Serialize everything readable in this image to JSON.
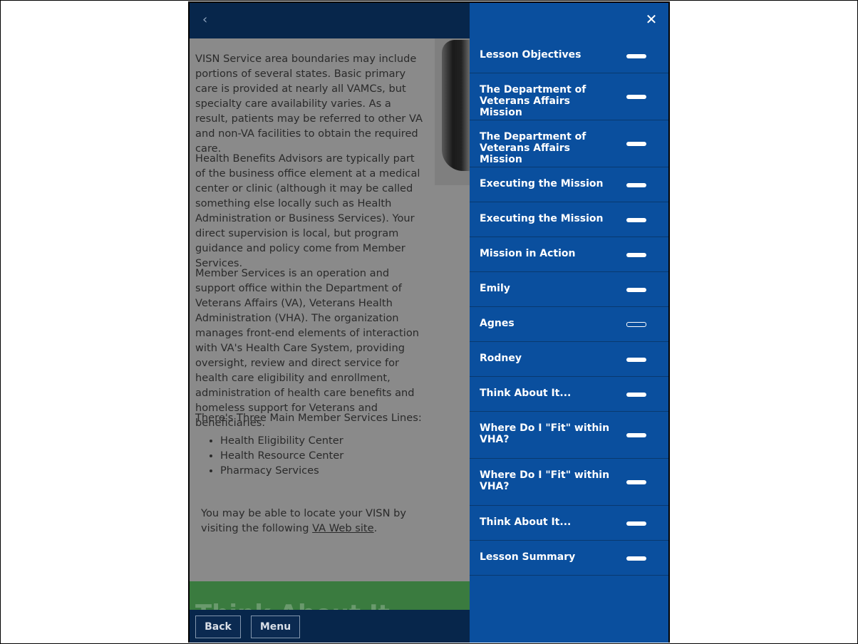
{
  "header": {
    "back_icon": "chevron-left-icon"
  },
  "article": {
    "p1": "VISN Service area boundaries may include portions of several states. Basic primary care is provided at nearly all VAMCs, but specialty care availability varies. As a result, patients may be referred to other VA and non-VA facilities to obtain the required care.",
    "p2": "Health Benefits Advisors are typically part of the business office element at a medical center or clinic (although it may be called something else locally such as Health Administration or Business Services). Your direct supervision is local, but program guidance and policy come from Member Services.",
    "p3": "Member Services is an operation and support office within the Department of Veterans Affairs (VA), Veterans Health Administration (VHA). The organization manages front-end elements of interaction with VA's Health Care System, providing oversight, review and direct service for health care eligibility and enrollment, administration of health care benefits and homeless support for Veterans and beneficiaries.",
    "p4": "There's Three Main Member Services Lines:",
    "bullets": [
      "Health Eligibility Center",
      "Health Resource Center",
      "Pharmacy Services"
    ],
    "visn_prefix": "You may be able to locate your VISN by visiting the following ",
    "visn_link": "VA Web site",
    "visn_suffix": ".",
    "next_section_title": "Think About It"
  },
  "footer": {
    "back_label": "Back",
    "menu_label": "Menu"
  },
  "menu": {
    "close_icon": "close-icon",
    "items": [
      {
        "label": "Lesson Objectives",
        "complete": true
      },
      {
        "label": "The Department of Veterans Affairs Mission",
        "complete": true
      },
      {
        "label": "The Department of Veterans Affairs Mission",
        "complete": true
      },
      {
        "label": "Executing the Mission",
        "complete": true
      },
      {
        "label": "Executing the Mission",
        "complete": true
      },
      {
        "label": "Mission in Action",
        "complete": true
      },
      {
        "label": "Emily",
        "complete": true
      },
      {
        "label": "Agnes",
        "complete": false
      },
      {
        "label": "Rodney",
        "complete": true
      },
      {
        "label": "Think About It...",
        "complete": true
      },
      {
        "label": "Where Do I \"Fit\" within VHA?",
        "complete": true
      },
      {
        "label": "Where Do I \"Fit\" within VHA?",
        "complete": true
      },
      {
        "label": "Think About It...",
        "complete": true
      },
      {
        "label": "Lesson Summary",
        "complete": true
      }
    ]
  },
  "colors": {
    "menu_bg": "#0a4f9e",
    "topbar_bg": "#07264b",
    "section_green": "#3a7b3f"
  }
}
